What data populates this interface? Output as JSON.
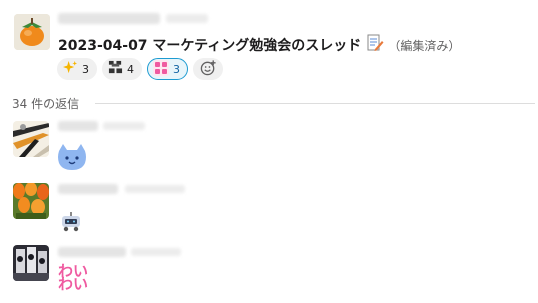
{
  "parent_message": {
    "title": "2023-04-07 マーケティング勉強会のスレッド",
    "edited_label": "（編集済み）",
    "title_icon": "memo-icon",
    "reactions": [
      {
        "icon": "sparkles-icon",
        "count": "3",
        "active": false
      },
      {
        "icon": "arigatai-stamp-icon",
        "count": "4",
        "active": false
      },
      {
        "icon": "waiwai-stamp-icon",
        "count": "3",
        "active": true
      }
    ],
    "add_reaction_icon": "add-reaction-icon"
  },
  "thread": {
    "reply_count_label": "34 件の返信"
  },
  "replies": [
    {
      "avatar": "abstract-art-avatar",
      "content_icon": "blue-cat-stamp-icon"
    },
    {
      "avatar": "tulip-avatar",
      "content_icon": "robot-stamp-icon"
    },
    {
      "avatar": "photo-avatar",
      "content_text": "わい わい"
    }
  ],
  "colors": {
    "accent": "#1d9bd1",
    "wai_pink": "#ef5aa0"
  }
}
